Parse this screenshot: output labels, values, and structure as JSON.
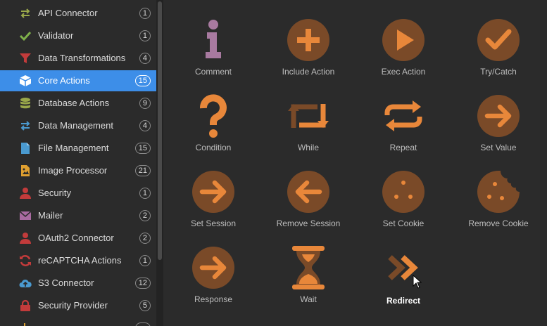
{
  "colors": {
    "accent": "#3d8ee8",
    "icon_orange": "#e8873a",
    "icon_circle": "#7a4a28",
    "icon_purple": "#a87aa0"
  },
  "sidebar": {
    "items": [
      {
        "label": "API Connector",
        "count": "1",
        "icon": "swap-arrows-icon"
      },
      {
        "label": "Validator",
        "count": "1",
        "icon": "checkmark-icon"
      },
      {
        "label": "Data Transformations",
        "count": "4",
        "icon": "funnel-icon"
      },
      {
        "label": "Core Actions",
        "count": "15",
        "icon": "cube-icon",
        "active": true
      },
      {
        "label": "Database Actions",
        "count": "9",
        "icon": "database-icon"
      },
      {
        "label": "Data Management",
        "count": "4",
        "icon": "swap-arrows-icon"
      },
      {
        "label": "File Management",
        "count": "15",
        "icon": "file-icon"
      },
      {
        "label": "Image Processor",
        "count": "21",
        "icon": "image-file-icon"
      },
      {
        "label": "Security",
        "count": "1",
        "icon": "user-icon"
      },
      {
        "label": "Mailer",
        "count": "2",
        "icon": "envelope-icon"
      },
      {
        "label": "OAuth2 Connector",
        "count": "2",
        "icon": "user-icon"
      },
      {
        "label": "reCAPTCHA Actions",
        "count": "1",
        "icon": "refresh-icon"
      },
      {
        "label": "S3 Connector",
        "count": "12",
        "icon": "cloud-upload-icon"
      },
      {
        "label": "Security Provider",
        "count": "5",
        "icon": "lock-icon"
      },
      {
        "label": "",
        "count": "",
        "icon": "partial-icon"
      }
    ]
  },
  "main": {
    "actions": [
      {
        "label": "Comment",
        "icon": "info-icon"
      },
      {
        "label": "Include Action",
        "icon": "plus-circle-icon"
      },
      {
        "label": "Exec Action",
        "icon": "play-circle-icon"
      },
      {
        "label": "Try/Catch",
        "icon": "check-circle-icon"
      },
      {
        "label": "Condition",
        "icon": "question-icon"
      },
      {
        "label": "While",
        "icon": "loop-icon"
      },
      {
        "label": "Repeat",
        "icon": "repeat-icon"
      },
      {
        "label": "Set Value",
        "icon": "arrow-right-circle-icon"
      },
      {
        "label": "Set Session",
        "icon": "arrow-right-circle-icon"
      },
      {
        "label": "Remove Session",
        "icon": "arrow-left-circle-icon"
      },
      {
        "label": "Set Cookie",
        "icon": "cookie-icon"
      },
      {
        "label": "Remove Cookie",
        "icon": "bitten-cookie-icon"
      },
      {
        "label": "Response",
        "icon": "arrow-right-circle-icon"
      },
      {
        "label": "Wait",
        "icon": "hourglass-icon"
      },
      {
        "label": "Redirect",
        "icon": "double-chevron-right-icon",
        "hover": true
      }
    ]
  }
}
